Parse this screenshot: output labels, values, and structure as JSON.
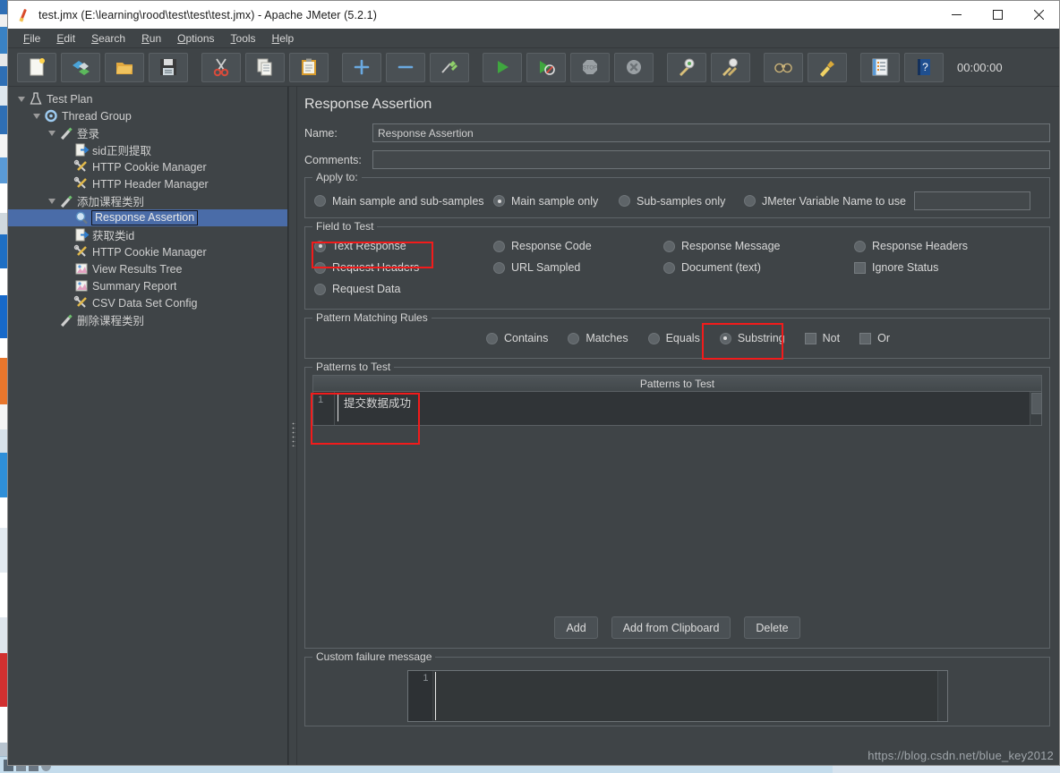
{
  "window": {
    "title": "test.jmx (E:\\learning\\rood\\test\\test\\test.jmx) - Apache JMeter (5.2.1)",
    "minimize_label": "Minimize",
    "maximize_label": "Maximize",
    "close_label": "Close"
  },
  "menubar": [
    {
      "label": "File",
      "mnemonic": "F"
    },
    {
      "label": "Edit",
      "mnemonic": "E"
    },
    {
      "label": "Search",
      "mnemonic": "S"
    },
    {
      "label": "Run",
      "mnemonic": "R"
    },
    {
      "label": "Options",
      "mnemonic": "O"
    },
    {
      "label": "Tools",
      "mnemonic": "T"
    },
    {
      "label": "Help",
      "mnemonic": "H"
    }
  ],
  "toolbar": {
    "buttons": [
      {
        "icon": "new-icon",
        "title": "New"
      },
      {
        "icon": "templates-icon",
        "title": "Templates"
      },
      {
        "icon": "open-icon",
        "title": "Open"
      },
      {
        "icon": "save-icon",
        "title": "Save"
      },
      {
        "icon": "cut-icon",
        "title": "Cut"
      },
      {
        "icon": "copy-icon",
        "title": "Copy"
      },
      {
        "icon": "paste-icon",
        "title": "Paste"
      },
      {
        "icon": "expand-icon",
        "title": "Expand All"
      },
      {
        "icon": "collapse-icon",
        "title": "Collapse All"
      },
      {
        "icon": "toggle-icon",
        "title": "Toggle"
      },
      {
        "icon": "start-icon",
        "title": "Start"
      },
      {
        "icon": "start-no-timers-icon",
        "title": "Start no pauses"
      },
      {
        "icon": "stop-icon",
        "title": "Stop"
      },
      {
        "icon": "shutdown-icon",
        "title": "Shutdown"
      },
      {
        "icon": "clear-icon",
        "title": "Clear"
      },
      {
        "icon": "clear-all-icon",
        "title": "Clear All"
      },
      {
        "icon": "search-icon",
        "title": "Search"
      },
      {
        "icon": "reset-search-icon",
        "title": "Reset Search"
      },
      {
        "icon": "function-helper-icon",
        "title": "Function Helper Dialog"
      },
      {
        "icon": "help-icon",
        "title": "Help"
      }
    ],
    "timer": "00:00:00"
  },
  "tree": {
    "items": [
      {
        "label": "Test Plan",
        "depth": 0,
        "twisty": true,
        "icon": "test-plan-icon",
        "selected": false
      },
      {
        "label": "Thread Group",
        "depth": 1,
        "twisty": true,
        "icon": "thread-group-icon",
        "selected": false
      },
      {
        "label": "登录",
        "depth": 2,
        "twisty": true,
        "icon": "http-sampler-icon",
        "selected": false
      },
      {
        "label": "sid正则提取",
        "depth": 3,
        "twisty": false,
        "icon": "extractor-icon",
        "selected": false
      },
      {
        "label": "HTTP Cookie Manager",
        "depth": 3,
        "twisty": false,
        "icon": "config-icon",
        "selected": false
      },
      {
        "label": "HTTP Header Manager",
        "depth": 3,
        "twisty": false,
        "icon": "config-icon",
        "selected": false
      },
      {
        "label": "添加课程类别",
        "depth": 2,
        "twisty": true,
        "icon": "http-sampler-icon",
        "selected": false
      },
      {
        "label": "Response Assertion",
        "depth": 3,
        "twisty": false,
        "icon": "assertion-icon",
        "selected": true
      },
      {
        "label": "获取类id",
        "depth": 3,
        "twisty": false,
        "icon": "extractor-icon",
        "selected": false
      },
      {
        "label": "HTTP Cookie Manager",
        "depth": 3,
        "twisty": false,
        "icon": "config-icon",
        "selected": false
      },
      {
        "label": "View Results Tree",
        "depth": 3,
        "twisty": false,
        "icon": "listener-icon",
        "selected": false
      },
      {
        "label": "Summary Report",
        "depth": 3,
        "twisty": false,
        "icon": "listener-icon",
        "selected": false
      },
      {
        "label": "CSV Data Set Config",
        "depth": 3,
        "twisty": false,
        "icon": "config-icon",
        "selected": false
      },
      {
        "label": "删除课程类别",
        "depth": 2,
        "twisty": false,
        "icon": "http-sampler-icon",
        "selected": false
      }
    ]
  },
  "main": {
    "title": "Response Assertion",
    "name_label": "Name:",
    "name_value": "Response Assertion",
    "comments_label": "Comments:",
    "comments_value": "",
    "apply_to": {
      "title": "Apply to:",
      "options": [
        {
          "label": "Main sample and sub-samples",
          "selected": false
        },
        {
          "label": "Main sample only",
          "selected": true
        },
        {
          "label": "Sub-samples only",
          "selected": false
        },
        {
          "label": "JMeter Variable Name to use",
          "selected": false
        }
      ],
      "variable_value": ""
    },
    "field_to_test": {
      "title": "Field to Test",
      "options": [
        {
          "label": "Text Response",
          "type": "radio",
          "selected": true,
          "highlighted": true
        },
        {
          "label": "Response Code",
          "type": "radio",
          "selected": false,
          "highlighted": false
        },
        {
          "label": "Response Message",
          "type": "radio",
          "selected": false,
          "highlighted": false
        },
        {
          "label": "Response Headers",
          "type": "radio",
          "selected": false,
          "highlighted": false
        },
        {
          "label": "Request Headers",
          "type": "radio",
          "selected": false,
          "highlighted": false
        },
        {
          "label": "URL Sampled",
          "type": "radio",
          "selected": false,
          "highlighted": false
        },
        {
          "label": "Document (text)",
          "type": "radio",
          "selected": false,
          "highlighted": false
        },
        {
          "label": "Ignore Status",
          "type": "checkbox",
          "selected": false,
          "highlighted": false
        },
        {
          "label": "Request Data",
          "type": "radio",
          "selected": false,
          "highlighted": false
        }
      ]
    },
    "pattern_rules": {
      "title": "Pattern Matching Rules",
      "options": [
        {
          "label": "Contains",
          "type": "radio",
          "selected": false,
          "highlighted": false
        },
        {
          "label": "Matches",
          "type": "radio",
          "selected": false,
          "highlighted": false
        },
        {
          "label": "Equals",
          "type": "radio",
          "selected": false,
          "highlighted": false
        },
        {
          "label": "Substring",
          "type": "radio",
          "selected": true,
          "highlighted": true
        },
        {
          "label": "Not",
          "type": "checkbox",
          "selected": false,
          "highlighted": false
        },
        {
          "label": "Or",
          "type": "checkbox",
          "selected": false,
          "highlighted": false
        }
      ]
    },
    "patterns": {
      "title": "Patterns to Test",
      "column_header": "Patterns to Test",
      "rows": [
        {
          "num": "1",
          "value": "提交数据成功"
        }
      ],
      "buttons": {
        "add": "Add",
        "add_from_clipboard": "Add from Clipboard",
        "delete": "Delete"
      }
    },
    "custom_failure": {
      "title": "Custom failure message",
      "line_number": "1",
      "value": ""
    }
  },
  "watermark": "https://blog.csdn.net/blue_key2012",
  "colors": {
    "window_bg": "#3f4447",
    "selection": "#4a6ca8",
    "highlight_red": "#f21b1b",
    "text": "#d6d6d6"
  }
}
